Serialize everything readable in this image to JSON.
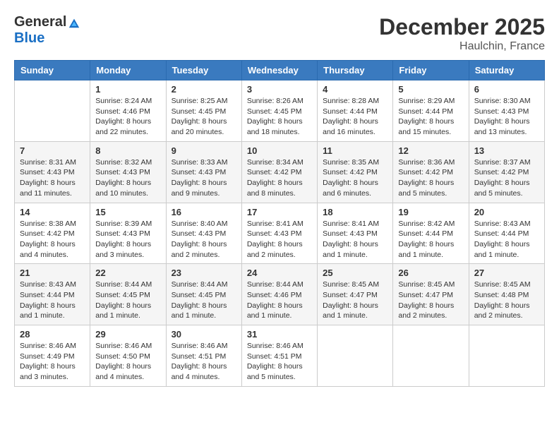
{
  "header": {
    "logo_line1": "General",
    "logo_line2": "Blue",
    "month": "December 2025",
    "location": "Haulchin, France"
  },
  "days_of_week": [
    "Sunday",
    "Monday",
    "Tuesday",
    "Wednesday",
    "Thursday",
    "Friday",
    "Saturday"
  ],
  "weeks": [
    [
      {
        "day": "",
        "sunrise": "",
        "sunset": "",
        "daylight": ""
      },
      {
        "day": "1",
        "sunrise": "Sunrise: 8:24 AM",
        "sunset": "Sunset: 4:46 PM",
        "daylight": "Daylight: 8 hours and 22 minutes."
      },
      {
        "day": "2",
        "sunrise": "Sunrise: 8:25 AM",
        "sunset": "Sunset: 4:45 PM",
        "daylight": "Daylight: 8 hours and 20 minutes."
      },
      {
        "day": "3",
        "sunrise": "Sunrise: 8:26 AM",
        "sunset": "Sunset: 4:45 PM",
        "daylight": "Daylight: 8 hours and 18 minutes."
      },
      {
        "day": "4",
        "sunrise": "Sunrise: 8:28 AM",
        "sunset": "Sunset: 4:44 PM",
        "daylight": "Daylight: 8 hours and 16 minutes."
      },
      {
        "day": "5",
        "sunrise": "Sunrise: 8:29 AM",
        "sunset": "Sunset: 4:44 PM",
        "daylight": "Daylight: 8 hours and 15 minutes."
      },
      {
        "day": "6",
        "sunrise": "Sunrise: 8:30 AM",
        "sunset": "Sunset: 4:43 PM",
        "daylight": "Daylight: 8 hours and 13 minutes."
      }
    ],
    [
      {
        "day": "7",
        "sunrise": "Sunrise: 8:31 AM",
        "sunset": "Sunset: 4:43 PM",
        "daylight": "Daylight: 8 hours and 11 minutes."
      },
      {
        "day": "8",
        "sunrise": "Sunrise: 8:32 AM",
        "sunset": "Sunset: 4:43 PM",
        "daylight": "Daylight: 8 hours and 10 minutes."
      },
      {
        "day": "9",
        "sunrise": "Sunrise: 8:33 AM",
        "sunset": "Sunset: 4:43 PM",
        "daylight": "Daylight: 8 hours and 9 minutes."
      },
      {
        "day": "10",
        "sunrise": "Sunrise: 8:34 AM",
        "sunset": "Sunset: 4:42 PM",
        "daylight": "Daylight: 8 hours and 8 minutes."
      },
      {
        "day": "11",
        "sunrise": "Sunrise: 8:35 AM",
        "sunset": "Sunset: 4:42 PM",
        "daylight": "Daylight: 8 hours and 6 minutes."
      },
      {
        "day": "12",
        "sunrise": "Sunrise: 8:36 AM",
        "sunset": "Sunset: 4:42 PM",
        "daylight": "Daylight: 8 hours and 5 minutes."
      },
      {
        "day": "13",
        "sunrise": "Sunrise: 8:37 AM",
        "sunset": "Sunset: 4:42 PM",
        "daylight": "Daylight: 8 hours and 5 minutes."
      }
    ],
    [
      {
        "day": "14",
        "sunrise": "Sunrise: 8:38 AM",
        "sunset": "Sunset: 4:42 PM",
        "daylight": "Daylight: 8 hours and 4 minutes."
      },
      {
        "day": "15",
        "sunrise": "Sunrise: 8:39 AM",
        "sunset": "Sunset: 4:43 PM",
        "daylight": "Daylight: 8 hours and 3 minutes."
      },
      {
        "day": "16",
        "sunrise": "Sunrise: 8:40 AM",
        "sunset": "Sunset: 4:43 PM",
        "daylight": "Daylight: 8 hours and 2 minutes."
      },
      {
        "day": "17",
        "sunrise": "Sunrise: 8:41 AM",
        "sunset": "Sunset: 4:43 PM",
        "daylight": "Daylight: 8 hours and 2 minutes."
      },
      {
        "day": "18",
        "sunrise": "Sunrise: 8:41 AM",
        "sunset": "Sunset: 4:43 PM",
        "daylight": "Daylight: 8 hours and 1 minute."
      },
      {
        "day": "19",
        "sunrise": "Sunrise: 8:42 AM",
        "sunset": "Sunset: 4:44 PM",
        "daylight": "Daylight: 8 hours and 1 minute."
      },
      {
        "day": "20",
        "sunrise": "Sunrise: 8:43 AM",
        "sunset": "Sunset: 4:44 PM",
        "daylight": "Daylight: 8 hours and 1 minute."
      }
    ],
    [
      {
        "day": "21",
        "sunrise": "Sunrise: 8:43 AM",
        "sunset": "Sunset: 4:44 PM",
        "daylight": "Daylight: 8 hours and 1 minute."
      },
      {
        "day": "22",
        "sunrise": "Sunrise: 8:44 AM",
        "sunset": "Sunset: 4:45 PM",
        "daylight": "Daylight: 8 hours and 1 minute."
      },
      {
        "day": "23",
        "sunrise": "Sunrise: 8:44 AM",
        "sunset": "Sunset: 4:45 PM",
        "daylight": "Daylight: 8 hours and 1 minute."
      },
      {
        "day": "24",
        "sunrise": "Sunrise: 8:44 AM",
        "sunset": "Sunset: 4:46 PM",
        "daylight": "Daylight: 8 hours and 1 minute."
      },
      {
        "day": "25",
        "sunrise": "Sunrise: 8:45 AM",
        "sunset": "Sunset: 4:47 PM",
        "daylight": "Daylight: 8 hours and 1 minute."
      },
      {
        "day": "26",
        "sunrise": "Sunrise: 8:45 AM",
        "sunset": "Sunset: 4:47 PM",
        "daylight": "Daylight: 8 hours and 2 minutes."
      },
      {
        "day": "27",
        "sunrise": "Sunrise: 8:45 AM",
        "sunset": "Sunset: 4:48 PM",
        "daylight": "Daylight: 8 hours and 2 minutes."
      }
    ],
    [
      {
        "day": "28",
        "sunrise": "Sunrise: 8:46 AM",
        "sunset": "Sunset: 4:49 PM",
        "daylight": "Daylight: 8 hours and 3 minutes."
      },
      {
        "day": "29",
        "sunrise": "Sunrise: 8:46 AM",
        "sunset": "Sunset: 4:50 PM",
        "daylight": "Daylight: 8 hours and 4 minutes."
      },
      {
        "day": "30",
        "sunrise": "Sunrise: 8:46 AM",
        "sunset": "Sunset: 4:51 PM",
        "daylight": "Daylight: 8 hours and 4 minutes."
      },
      {
        "day": "31",
        "sunrise": "Sunrise: 8:46 AM",
        "sunset": "Sunset: 4:51 PM",
        "daylight": "Daylight: 8 hours and 5 minutes."
      },
      {
        "day": "",
        "sunrise": "",
        "sunset": "",
        "daylight": ""
      },
      {
        "day": "",
        "sunrise": "",
        "sunset": "",
        "daylight": ""
      },
      {
        "day": "",
        "sunrise": "",
        "sunset": "",
        "daylight": ""
      }
    ]
  ]
}
